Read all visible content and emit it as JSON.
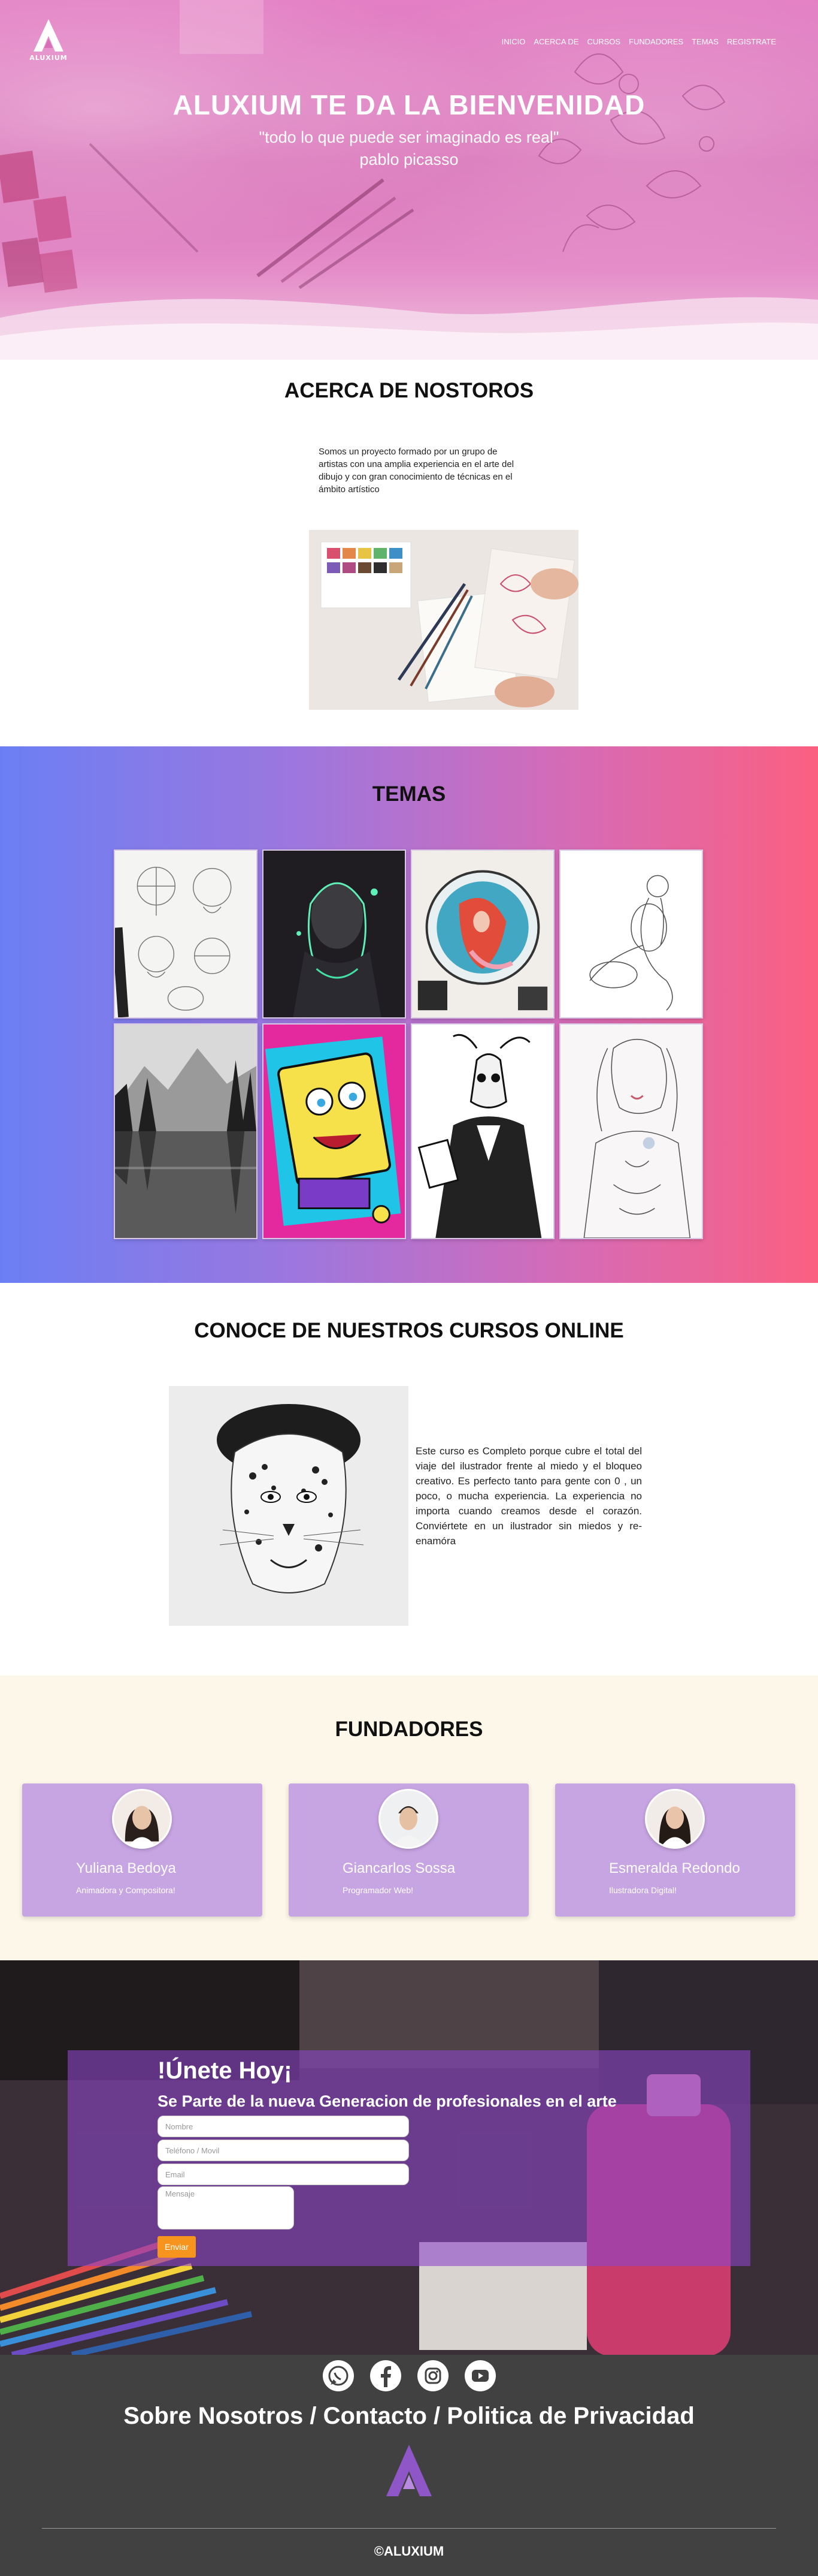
{
  "brand": {
    "name": "ALUXIUM"
  },
  "nav": [
    {
      "label": "INICIO"
    },
    {
      "label": "ACERCA DE"
    },
    {
      "label": "CURSOS"
    },
    {
      "label": "FUNDADORES"
    },
    {
      "label": "TEMAS"
    },
    {
      "label": "REGISTRATE"
    }
  ],
  "hero": {
    "title": "ALUXIUM TE DA LA BIENVENIDAD",
    "quote": "\"todo lo que puede ser imaginado es real\"",
    "author": "pablo picasso"
  },
  "about": {
    "title": "ACERCA DE NOSTOROS",
    "text": "Somos un proyecto formado por un grupo de artistas con una amplia experiencia en el arte del dibujo y con gran conocimiento de técnicas en el ámbito artístico"
  },
  "themes": {
    "title": "TEMAS",
    "tiles": [
      {
        "icon": "head-sketches-image"
      },
      {
        "icon": "neon-girl-drawing-image"
      },
      {
        "icon": "mermaid-watercolor-image"
      },
      {
        "icon": "figure-sketch-image"
      },
      {
        "icon": "mountain-lake-image"
      },
      {
        "icon": "sponge-character-image"
      },
      {
        "icon": "skull-deer-man-image"
      },
      {
        "icon": "tattooed-woman-image"
      }
    ]
  },
  "courses": {
    "title": "CONOCE DE NUESTROS CURSOS ONLINE",
    "text": "Este curso es Completo porque cubre el total del viaje del ilustrador frente al miedo y el bloqueo creativo. Es perfecto tanto para gente con 0 , un poco, o mucha experiencia. La experiencia no importa cuando creamos desde el corazón. Conviértete en un ilustrador sin miedos y re-enamóra"
  },
  "founders": {
    "title": "FUNDADORES",
    "people": [
      {
        "name": "Yuliana Bedoya",
        "role": "Animadora y Compositora!"
      },
      {
        "name": "Giancarlos Sossa",
        "role": "Programador Web!"
      },
      {
        "name": "Esmeralda Redondo",
        "role": "Ilustradora Digital!"
      }
    ]
  },
  "join": {
    "title": "!Únete Hoy¡",
    "subtitle": "Se Parte de la nueva Generacion de profesionales en el arte",
    "name_placeholder": "Nombre",
    "phone_placeholder": "Teléfono / Movil",
    "email_placeholder": "Email",
    "message_placeholder": "Mensaje",
    "submit_label": "Enviar"
  },
  "footer": {
    "socials": [
      {
        "icon": "whatsapp-icon"
      },
      {
        "icon": "facebook-icon"
      },
      {
        "icon": "instagram-icon"
      },
      {
        "icon": "youtube-icon"
      }
    ],
    "links": "Sobre Nosotros / Contacto / Politica de Privacidad",
    "copyright": "©ALUXIUM"
  },
  "colors": {
    "hero_pink": "#d86fb7",
    "themes_start": "#6b7ff4",
    "themes_end": "#fb6081",
    "card": "#c7a4e2",
    "founders_bg": "#fdf7e9",
    "submit": "#f7941d",
    "footer_bg": "#414141"
  }
}
